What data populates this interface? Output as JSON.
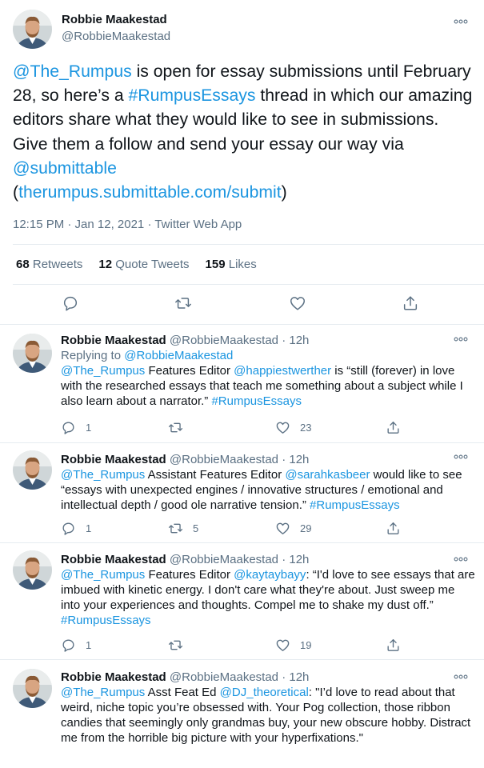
{
  "main_tweet": {
    "author_name": "Robbie Maakestad",
    "author_handle": "@RobbieMaakestad",
    "text_parts": [
      {
        "t": "@The_Rumpus",
        "link": true
      },
      {
        "t": " is open for essay submissions until February 28, so here’s a ",
        "link": false
      },
      {
        "t": "#RumpusEssays",
        "link": true
      },
      {
        "t": " thread in which our amazing editors share what they would like to see in submissions. Give them a follow and send your essay our way via ",
        "link": false
      },
      {
        "t": "@submittable",
        "link": true
      },
      {
        "t": " (",
        "link": false
      },
      {
        "t": "therumpus.submittable.com/submit",
        "link": true
      },
      {
        "t": ")",
        "link": false
      }
    ],
    "meta": "12:15 PM · Jan 12, 2021 · Twitter Web App",
    "stats": [
      {
        "count": "68",
        "label": "Retweets"
      },
      {
        "count": "12",
        "label": "Quote Tweets"
      },
      {
        "count": "159",
        "label": "Likes"
      }
    ],
    "actions": [
      "reply-icon",
      "retweet-icon",
      "like-icon",
      "share-icon"
    ]
  },
  "replies": [
    {
      "name": "Robbie Maakestad",
      "handle_time": "@RobbieMaakestad · 12h",
      "replying_label": "Replying to ",
      "replying_to": "@RobbieMaakestad",
      "text_parts": [
        {
          "t": "@The_Rumpus",
          "link": true
        },
        {
          "t": " Features Editor ",
          "link": false
        },
        {
          "t": "@happiestwerther",
          "link": true
        },
        {
          "t": " is “still (forever) in love with the researched essays that teach me something about a subject while I also learn about a narrator.” ",
          "link": false
        },
        {
          "t": "#RumpusEssays",
          "link": true
        }
      ],
      "replies": "1",
      "retweets": "",
      "likes": "23"
    },
    {
      "name": "Robbie Maakestad",
      "handle_time": "@RobbieMaakestad · 12h",
      "text_parts": [
        {
          "t": "@The_Rumpus",
          "link": true
        },
        {
          "t": " Assistant Features Editor ",
          "link": false
        },
        {
          "t": "@sarahkasbeer",
          "link": true
        },
        {
          "t": " would like to see “essays with unexpected engines / innovative structures / emotional and intellectual depth / good ole narrative tension.” ",
          "link": false
        },
        {
          "t": "#RumpusEssays",
          "link": true
        }
      ],
      "replies": "1",
      "retweets": "5",
      "likes": "29"
    },
    {
      "name": "Robbie Maakestad",
      "handle_time": "@RobbieMaakestad · 12h",
      "text_parts": [
        {
          "t": "@The_Rumpus",
          "link": true
        },
        {
          "t": " Features Editor ",
          "link": false
        },
        {
          "t": "@kaytaybayy",
          "link": true
        },
        {
          "t": ": “I'd love to see essays that are imbued with kinetic energy. I don't care what they're about. Just sweep me into your experiences and thoughts. Compel me to shake my dust off.” ",
          "link": false
        },
        {
          "t": "#RumpusEssays",
          "link": true
        }
      ],
      "replies": "1",
      "retweets": "",
      "likes": "19"
    },
    {
      "name": "Robbie Maakestad",
      "handle_time": "@RobbieMaakestad · 12h",
      "text_parts": [
        {
          "t": "@The_Rumpus",
          "link": true
        },
        {
          "t": " Asst Feat Ed ",
          "link": false
        },
        {
          "t": "@DJ_theoretical",
          "link": true
        },
        {
          "t": ": \"I’d love to read about that weird, niche topic you’re obsessed with. Your Pog collection, those ribbon candies that seemingly only grandmas buy, your new obscure hobby. Distract me from the horrible big picture with your hyperfixations.\"",
          "link": false
        }
      ]
    }
  ],
  "colors": {
    "link": "#1b95e0",
    "muted": "#5b7083",
    "divider": "#e6ecf0"
  }
}
